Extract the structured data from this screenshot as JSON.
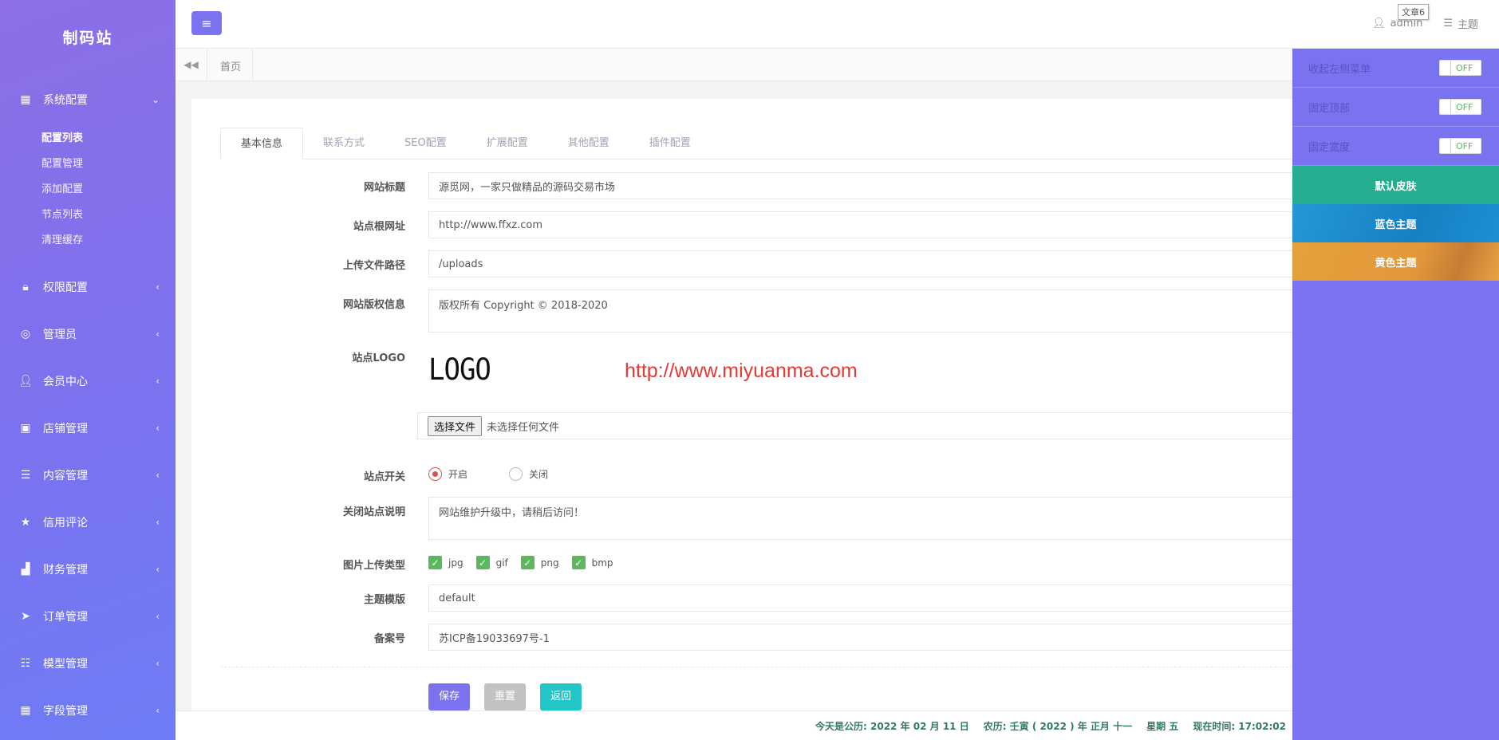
{
  "sidebar": {
    "brand": "制码站",
    "menu": [
      {
        "label": "系统配置",
        "icon": "grid-icon",
        "open": true
      },
      {
        "label": "权限配置",
        "icon": "lock-icon"
      },
      {
        "label": "管理员",
        "icon": "target-icon"
      },
      {
        "label": "会员中心",
        "icon": "user-icon"
      },
      {
        "label": "店铺管理",
        "icon": "store-icon"
      },
      {
        "label": "内容管理",
        "icon": "list-icon"
      },
      {
        "label": "信用评论",
        "icon": "star-icon"
      },
      {
        "label": "财务管理",
        "icon": "chart-icon"
      },
      {
        "label": "订单管理",
        "icon": "send-icon"
      },
      {
        "label": "模型管理",
        "icon": "stack-icon"
      },
      {
        "label": "字段管理",
        "icon": "grid-icon"
      }
    ],
    "submenu": [
      "配置列表",
      "配置管理",
      "添加配置",
      "节点列表",
      "清理缓存"
    ]
  },
  "topbar": {
    "tooltip": "文章6",
    "user": "admin",
    "theme": "主题"
  },
  "breadcrumb": {
    "home": "首页"
  },
  "tabs": [
    "基本信息",
    "联系方式",
    "SEO配置",
    "扩展配置",
    "其他配置",
    "插件配置"
  ],
  "form": {
    "site_title": {
      "label": "网站标题",
      "value": "源觅网，一家只做精品的源码交易市场"
    },
    "site_url": {
      "label": "站点根网址",
      "value": "http://www.ffxz.com"
    },
    "upload_path": {
      "label": "上传文件路径",
      "value": "/uploads"
    },
    "copyright": {
      "label": "网站版权信息",
      "value": "版权所有 Copyright © 2018-2020"
    },
    "logo": {
      "label": "站点LOGO",
      "logo_text": "LOGO",
      "watermark": "http://www.miyuanma.com",
      "choose_button": "选择文件",
      "no_file": "未选择任何文件"
    },
    "site_switch": {
      "label": "站点开关",
      "options": [
        "开启",
        "关闭"
      ],
      "selected": "开启"
    },
    "close_note": {
      "label": "关闭站点说明",
      "value": "网站维护升级中，请稍后访问！"
    },
    "upload_types": {
      "label": "图片上传类型",
      "options": [
        "jpg",
        "gif",
        "png",
        "bmp"
      ]
    },
    "template": {
      "label": "主题模版",
      "value": "default"
    },
    "icp": {
      "label": "备案号",
      "value": "苏ICP备19033697号-1"
    }
  },
  "buttons": {
    "save": "保存",
    "reset": "重置",
    "back": "返回"
  },
  "footer": {
    "solar": "今天是公历: 2022 年 02 月 11 日",
    "lunar": "农历: 壬寅 ( 2022 ) 年  正月 十一",
    "weekday": "星期 五",
    "time": "现在时间: 17:02:02"
  },
  "theme_panel": {
    "options": [
      {
        "label": "收起左侧菜单",
        "state": "OFF"
      },
      {
        "label": "固定顶部",
        "state": "OFF"
      },
      {
        "label": "固定宽度",
        "state": "OFF"
      }
    ],
    "skins": [
      "默认皮肤",
      "蓝色主题",
      "黄色主题"
    ]
  },
  "colors": {
    "primary": "#7b72ef",
    "teal": "#23c6c8",
    "danger": "#d9534f",
    "success": "#5cb85c"
  }
}
